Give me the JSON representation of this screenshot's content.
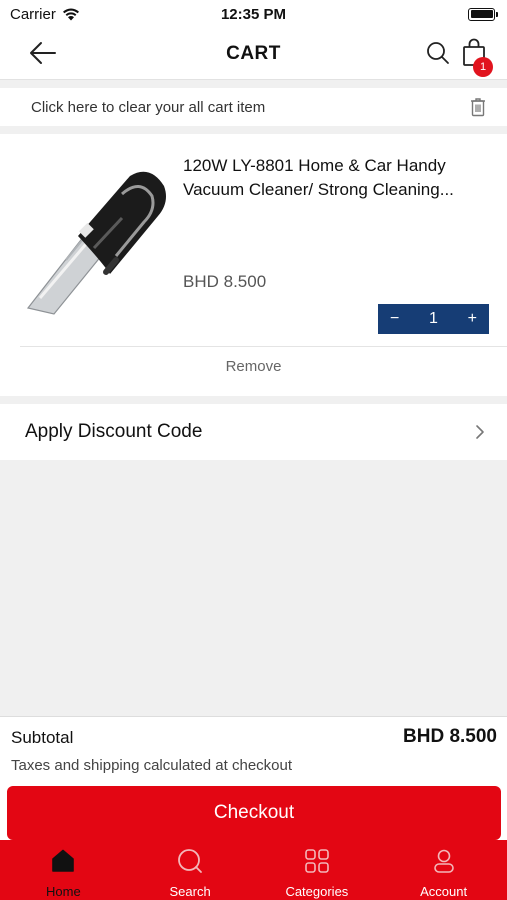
{
  "status": {
    "carrier": "Carrier",
    "time": "12:35 PM"
  },
  "header": {
    "title": "CART",
    "cart_count": "1"
  },
  "clear_cart": {
    "label": "Click here to clear your all cart item"
  },
  "cart_items": [
    {
      "name": "120W LY-8801 Home & Car Handy Vacuum Cleaner/ Strong Cleaning...",
      "price": "BHD 8.500",
      "quantity": "1",
      "remove_label": "Remove"
    }
  ],
  "discount": {
    "label": "Apply Discount Code"
  },
  "summary": {
    "subtotal_label": "Subtotal",
    "subtotal_value": "BHD 8.500",
    "tax_note": "Taxes and shipping calculated at checkout",
    "checkout_label": "Checkout"
  },
  "tabs": [
    {
      "label": "Home",
      "icon": "home-icon",
      "active": true
    },
    {
      "label": "Search",
      "icon": "search-icon",
      "active": false
    },
    {
      "label": "Categories",
      "icon": "grid-icon",
      "active": false
    },
    {
      "label": "Account",
      "icon": "user-icon",
      "active": false
    }
  ],
  "colors": {
    "brand_red": "#e30613",
    "qty_blue": "#163d75",
    "badge_red": "#e1141e"
  }
}
